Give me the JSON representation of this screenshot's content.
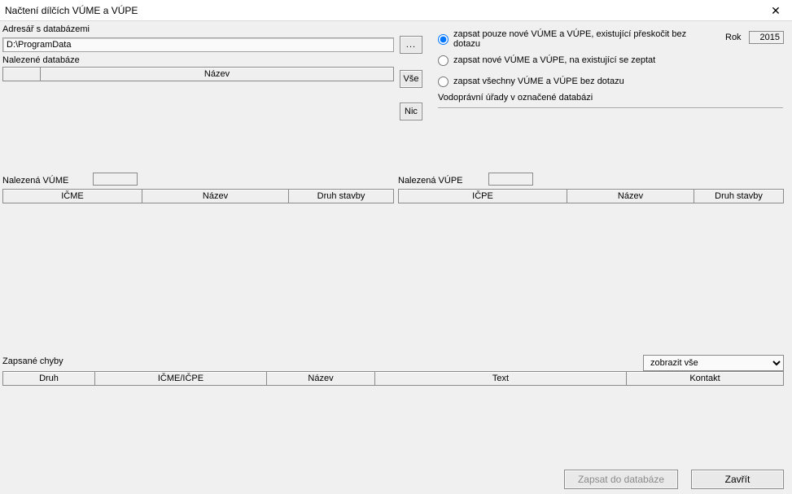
{
  "window": {
    "title": "Načtení dílčích VÚME a VÚPE"
  },
  "dir": {
    "label": "Adresář s databázemi",
    "value": "D:\\ProgramData",
    "browse_label": "..."
  },
  "found_db": {
    "label": "Nalezené databáze",
    "columns": {
      "blank": "",
      "nazev": "Název"
    }
  },
  "side_buttons": {
    "vse": "Vše",
    "nic": "Nic"
  },
  "options": {
    "selected": 0,
    "items": [
      "zapsat pouze nové VÚME a VÚPE, existující přeskočit bez dotazu",
      "zapsat nové VÚME a VÚPE, na existující se zeptat",
      "zapsat všechny VÚME a VÚPE bez dotazu"
    ]
  },
  "rok": {
    "label": "Rok",
    "value": "2015"
  },
  "vodo": {
    "label": "Vodoprávní úřady v označené databázi"
  },
  "vume": {
    "label": "Nalezená VÚME",
    "count": "",
    "columns": {
      "icme": "IČME",
      "nazev": "Název",
      "druh": "Druh stavby"
    }
  },
  "vupe": {
    "label": "Nalezená VÚPE",
    "count": "",
    "columns": {
      "icpe": "IČPE",
      "nazev": "Název",
      "druh": "Druh stavby"
    }
  },
  "errors": {
    "label": "Zapsané chyby",
    "filter_selected": "zobrazit vše",
    "filter_options": [
      "zobrazit vše"
    ],
    "columns": {
      "druh": "Druh",
      "icmeicpe": "IČME/IČPE",
      "nazev": "Název",
      "text": "Text",
      "kontakt": "Kontakt"
    }
  },
  "footer": {
    "zapsat": "Zapsat do databáze",
    "zavrit": "Zavřít"
  }
}
